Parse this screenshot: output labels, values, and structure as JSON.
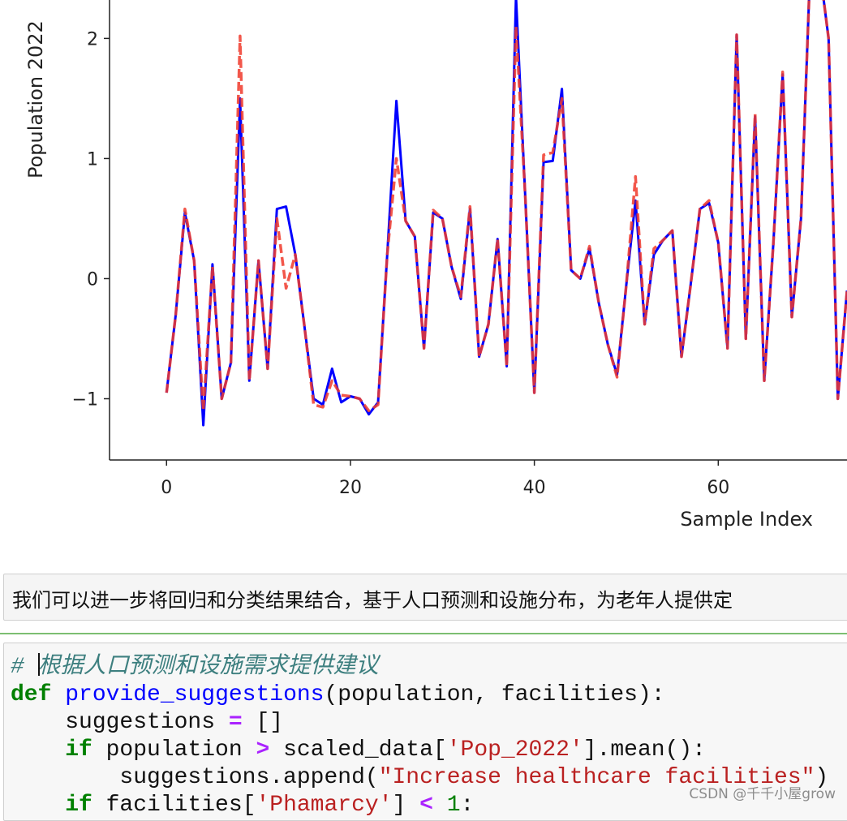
{
  "chart_data": {
    "type": "line",
    "xlabel": "Sample Index",
    "ylabel": "Population 2022",
    "x_ticks": [
      0,
      20,
      40,
      60
    ],
    "y_ticks": [
      -1,
      0,
      1,
      2
    ],
    "xlim": [
      -6.2,
      74
    ],
    "ylim": [
      -1.51,
      2.32
    ],
    "grid": false,
    "series": [
      {
        "color": "#0000ff",
        "style": "solid",
        "values": [
          -0.95,
          -0.3,
          0.55,
          0.15,
          -1.22,
          0.12,
          -1.0,
          -0.7,
          1.5,
          -0.85,
          0.15,
          -0.75,
          0.58,
          0.6,
          0.2,
          -0.4,
          -1.0,
          -1.05,
          -0.75,
          -1.03,
          -0.98,
          -1.0,
          -1.13,
          -1.03,
          0.2,
          1.48,
          0.48,
          0.35,
          -0.58,
          0.55,
          0.5,
          0.1,
          -0.17,
          0.58,
          -0.65,
          -0.38,
          0.33,
          -0.73,
          2.35,
          0.7,
          -0.95,
          0.97,
          0.98,
          1.58,
          0.07,
          0.0,
          0.25,
          -0.2,
          -0.55,
          -0.8,
          -0.05,
          0.65,
          -0.38,
          0.2,
          0.32,
          0.4,
          -0.65,
          -0.05,
          0.58,
          0.63,
          0.3,
          -0.58,
          2.03,
          -0.5,
          1.35,
          -0.85,
          0.3,
          1.7,
          -0.32,
          0.5,
          2.6,
          2.6,
          2.0,
          -1.0,
          -0.1
        ]
      },
      {
        "color": "#f03a2c",
        "style": "dashed",
        "values": [
          -0.95,
          -0.3,
          0.58,
          0.15,
          -1.1,
          0.1,
          -1.0,
          -0.7,
          2.02,
          -0.85,
          0.15,
          -0.75,
          0.5,
          -0.08,
          0.2,
          -0.4,
          -1.05,
          -1.07,
          -0.85,
          -0.97,
          -0.98,
          -1.0,
          -1.1,
          -1.05,
          0.2,
          1.0,
          0.48,
          0.35,
          -0.58,
          0.57,
          0.5,
          0.1,
          -0.15,
          0.6,
          -0.65,
          -0.38,
          0.33,
          -0.73,
          2.1,
          0.7,
          -0.95,
          1.03,
          1.05,
          1.5,
          0.07,
          0.0,
          0.27,
          -0.2,
          -0.55,
          -0.82,
          -0.05,
          0.85,
          -0.38,
          0.25,
          0.32,
          0.4,
          -0.65,
          -0.05,
          0.58,
          0.65,
          0.3,
          -0.58,
          2.03,
          -0.5,
          1.37,
          -0.85,
          0.3,
          1.72,
          -0.32,
          0.5,
          2.6,
          2.6,
          2.0,
          -1.0,
          -0.1
        ]
      }
    ]
  },
  "markdown": {
    "text": "我们可以进一步将回归和分类结果结合，基于人口预测和设施分布，为老年人提供定"
  },
  "code": {
    "lines": [
      [
        {
          "t": "# ",
          "c": "comment"
        },
        {
          "cursor": true
        },
        {
          "t": "根据人口预测和设施需求提供建议",
          "c": "comment"
        }
      ],
      [
        {
          "t": "def",
          "c": "kw"
        },
        {
          "t": " ",
          "c": "plain"
        },
        {
          "t": "provide_suggestions",
          "c": "fn"
        },
        {
          "t": "(population, facilities):",
          "c": "plain"
        }
      ],
      [
        {
          "t": "    suggestions ",
          "c": "plain"
        },
        {
          "t": "=",
          "c": "op"
        },
        {
          "t": " []",
          "c": "plain"
        }
      ],
      [
        {
          "t": "    ",
          "c": "plain"
        },
        {
          "t": "if",
          "c": "kw"
        },
        {
          "t": " population ",
          "c": "plain"
        },
        {
          "t": ">",
          "c": "op"
        },
        {
          "t": " scaled_data[",
          "c": "plain"
        },
        {
          "t": "'Pop_2022'",
          "c": "str"
        },
        {
          "t": "].mean():",
          "c": "plain"
        }
      ],
      [
        {
          "t": "        suggestions.append(",
          "c": "plain"
        },
        {
          "t": "\"Increase healthcare facilities\"",
          "c": "str"
        },
        {
          "t": ")",
          "c": "plain"
        }
      ],
      [
        {
          "t": "    ",
          "c": "plain"
        },
        {
          "t": "if",
          "c": "kw"
        },
        {
          "t": " facilities[",
          "c": "plain"
        },
        {
          "t": "'Phamarcy'",
          "c": "str"
        },
        {
          "t": "] ",
          "c": "plain"
        },
        {
          "t": "<",
          "c": "op"
        },
        {
          "t": " ",
          "c": "plain"
        },
        {
          "t": "1",
          "c": "num"
        },
        {
          "t": ":",
          "c": "plain"
        }
      ]
    ]
  },
  "watermark": "CSDN @千千小屋grow"
}
